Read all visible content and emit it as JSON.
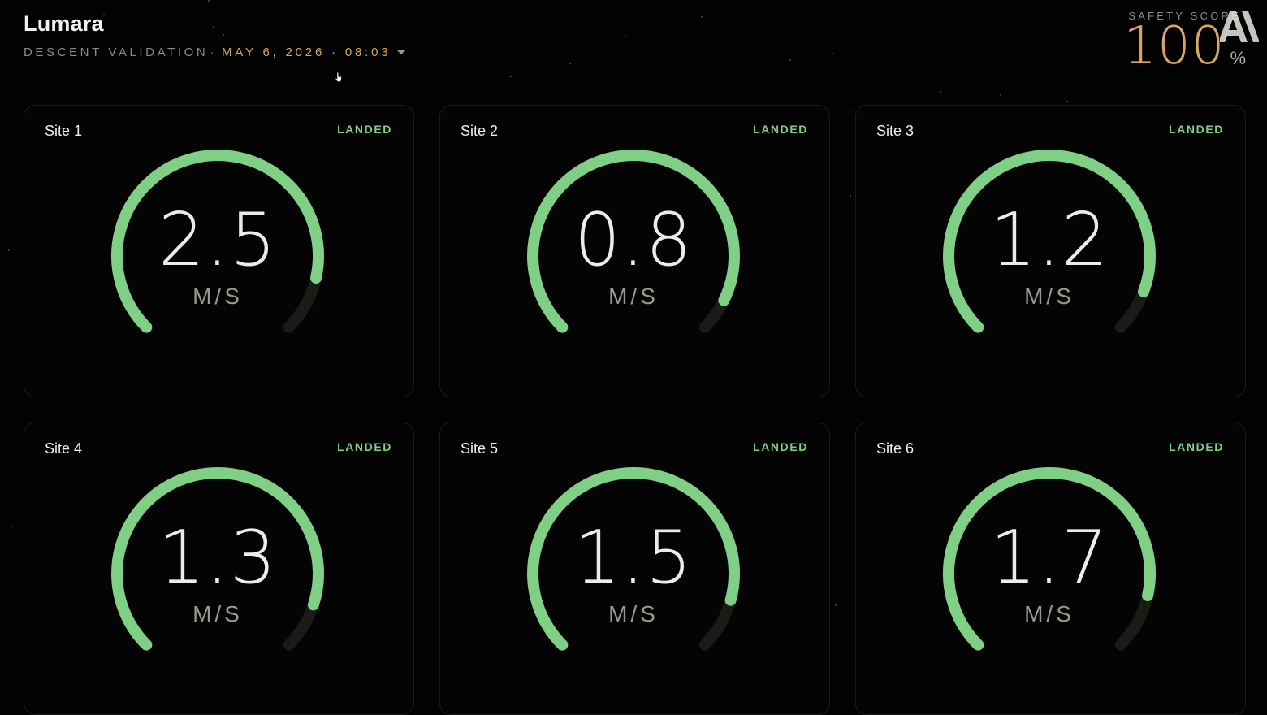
{
  "app": {
    "title": "Lumara",
    "subtitle": "DESCENT VALIDATION",
    "separator": "·",
    "datetime": "MAY 6, 2026 · 08:03"
  },
  "safety": {
    "label": "SAFETY SCORE",
    "value": "100",
    "unit": "%"
  },
  "icons": {
    "dropdown": "chevron-down-icon",
    "logo": "anthropic-logo-icon",
    "cursor": "mouse-pointer-icon"
  },
  "colors": {
    "accent_gold": "#d6a85c",
    "status_green": "#7fcf84",
    "gauge_track": "#1a1a16"
  },
  "sites": [
    {
      "name": "Site 1",
      "status": "LANDED",
      "value": "2.5",
      "unit": "M/S",
      "fill": 0.88
    },
    {
      "name": "Site 2",
      "status": "LANDED",
      "value": "0.8",
      "unit": "M/S",
      "fill": 0.93
    },
    {
      "name": "Site 3",
      "status": "LANDED",
      "value": "1.2",
      "unit": "M/S",
      "fill": 0.91
    },
    {
      "name": "Site 4",
      "status": "LANDED",
      "value": "1.3",
      "unit": "M/S",
      "fill": 0.9
    },
    {
      "name": "Site 5",
      "status": "LANDED",
      "value": "1.5",
      "unit": "M/S",
      "fill": 0.89
    },
    {
      "name": "Site 6",
      "status": "LANDED",
      "value": "1.7",
      "unit": "M/S",
      "fill": 0.88
    }
  ]
}
